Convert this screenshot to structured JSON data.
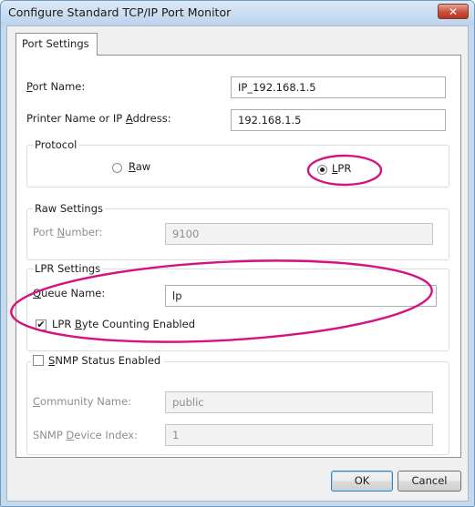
{
  "window": {
    "title": "Configure Standard TCP/IP Port Monitor",
    "close_glyph": "✕"
  },
  "tab": {
    "label": "Port Settings"
  },
  "port_name": {
    "label_pre": "",
    "label_key": "P",
    "label_post": "ort Name:",
    "value": "IP_192.168.1.5"
  },
  "printer_address": {
    "label_pre": "Printer Name or IP ",
    "label_key": "A",
    "label_post": "ddress:",
    "value": "192.168.1.5"
  },
  "protocol": {
    "legend": "Protocol",
    "raw": {
      "label_pre": "",
      "label_key": "R",
      "label_post": "aw",
      "selected": false
    },
    "lpr": {
      "label_pre": "",
      "label_key": "L",
      "label_post": "PR",
      "selected": true
    }
  },
  "raw_settings": {
    "legend": "Raw Settings",
    "port_number": {
      "label_pre": "Port ",
      "label_key": "N",
      "label_post": "umber:",
      "value": "9100"
    }
  },
  "lpr_settings": {
    "legend": "LPR Settings",
    "queue_name": {
      "label_pre": "",
      "label_key": "Q",
      "label_post": "ueue Name:",
      "value": "lp"
    },
    "byte_counting": {
      "label_pre": "LPR ",
      "label_key": "B",
      "label_post": "yte Counting Enabled",
      "checked": true,
      "check_glyph": "✔"
    }
  },
  "snmp": {
    "enable": {
      "label_pre": "",
      "label_key": "S",
      "label_post": "NMP Status Enabled",
      "checked": false
    },
    "community": {
      "label_pre": "",
      "label_key": "C",
      "label_post": "ommunity Name:",
      "value": "public"
    },
    "device_index": {
      "label_pre": "SNMP ",
      "label_key": "D",
      "label_post": "evice Index:",
      "value": "1"
    }
  },
  "buttons": {
    "ok": "OK",
    "cancel": "Cancel"
  },
  "annotation": {
    "color": "#d6127e"
  }
}
